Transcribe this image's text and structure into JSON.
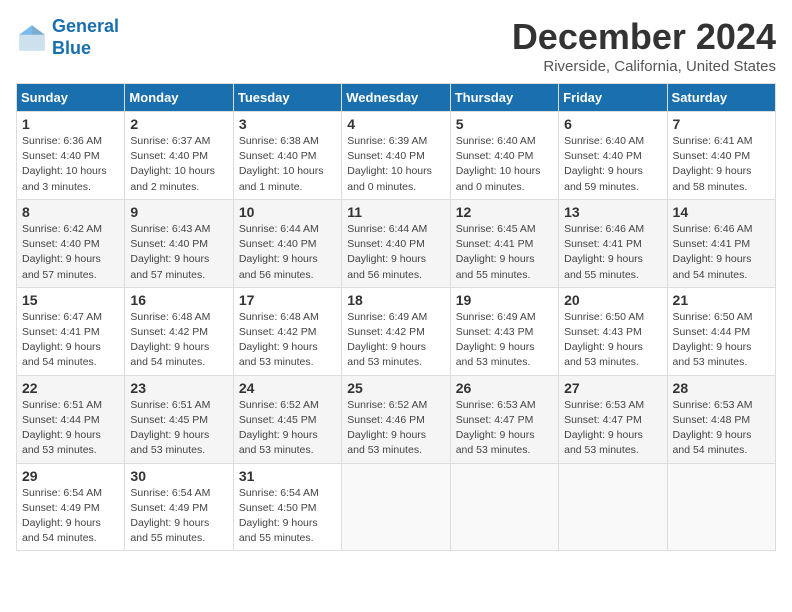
{
  "header": {
    "logo_line1": "General",
    "logo_line2": "Blue",
    "title": "December 2024",
    "subtitle": "Riverside, California, United States"
  },
  "calendar": {
    "days_of_week": [
      "Sunday",
      "Monday",
      "Tuesday",
      "Wednesday",
      "Thursday",
      "Friday",
      "Saturday"
    ],
    "weeks": [
      [
        {
          "day": "1",
          "sunrise": "6:36 AM",
          "sunset": "4:40 PM",
          "daylight": "10 hours and 3 minutes."
        },
        {
          "day": "2",
          "sunrise": "6:37 AM",
          "sunset": "4:40 PM",
          "daylight": "10 hours and 2 minutes."
        },
        {
          "day": "3",
          "sunrise": "6:38 AM",
          "sunset": "4:40 PM",
          "daylight": "10 hours and 1 minute."
        },
        {
          "day": "4",
          "sunrise": "6:39 AM",
          "sunset": "4:40 PM",
          "daylight": "10 hours and 0 minutes."
        },
        {
          "day": "5",
          "sunrise": "6:40 AM",
          "sunset": "4:40 PM",
          "daylight": "10 hours and 0 minutes."
        },
        {
          "day": "6",
          "sunrise": "6:40 AM",
          "sunset": "4:40 PM",
          "daylight": "9 hours and 59 minutes."
        },
        {
          "day": "7",
          "sunrise": "6:41 AM",
          "sunset": "4:40 PM",
          "daylight": "9 hours and 58 minutes."
        }
      ],
      [
        {
          "day": "8",
          "sunrise": "6:42 AM",
          "sunset": "4:40 PM",
          "daylight": "9 hours and 57 minutes."
        },
        {
          "day": "9",
          "sunrise": "6:43 AM",
          "sunset": "4:40 PM",
          "daylight": "9 hours and 57 minutes."
        },
        {
          "day": "10",
          "sunrise": "6:44 AM",
          "sunset": "4:40 PM",
          "daylight": "9 hours and 56 minutes."
        },
        {
          "day": "11",
          "sunrise": "6:44 AM",
          "sunset": "4:40 PM",
          "daylight": "9 hours and 56 minutes."
        },
        {
          "day": "12",
          "sunrise": "6:45 AM",
          "sunset": "4:41 PM",
          "daylight": "9 hours and 55 minutes."
        },
        {
          "day": "13",
          "sunrise": "6:46 AM",
          "sunset": "4:41 PM",
          "daylight": "9 hours and 55 minutes."
        },
        {
          "day": "14",
          "sunrise": "6:46 AM",
          "sunset": "4:41 PM",
          "daylight": "9 hours and 54 minutes."
        }
      ],
      [
        {
          "day": "15",
          "sunrise": "6:47 AM",
          "sunset": "4:41 PM",
          "daylight": "9 hours and 54 minutes."
        },
        {
          "day": "16",
          "sunrise": "6:48 AM",
          "sunset": "4:42 PM",
          "daylight": "9 hours and 54 minutes."
        },
        {
          "day": "17",
          "sunrise": "6:48 AM",
          "sunset": "4:42 PM",
          "daylight": "9 hours and 53 minutes."
        },
        {
          "day": "18",
          "sunrise": "6:49 AM",
          "sunset": "4:42 PM",
          "daylight": "9 hours and 53 minutes."
        },
        {
          "day": "19",
          "sunrise": "6:49 AM",
          "sunset": "4:43 PM",
          "daylight": "9 hours and 53 minutes."
        },
        {
          "day": "20",
          "sunrise": "6:50 AM",
          "sunset": "4:43 PM",
          "daylight": "9 hours and 53 minutes."
        },
        {
          "day": "21",
          "sunrise": "6:50 AM",
          "sunset": "4:44 PM",
          "daylight": "9 hours and 53 minutes."
        }
      ],
      [
        {
          "day": "22",
          "sunrise": "6:51 AM",
          "sunset": "4:44 PM",
          "daylight": "9 hours and 53 minutes."
        },
        {
          "day": "23",
          "sunrise": "6:51 AM",
          "sunset": "4:45 PM",
          "daylight": "9 hours and 53 minutes."
        },
        {
          "day": "24",
          "sunrise": "6:52 AM",
          "sunset": "4:45 PM",
          "daylight": "9 hours and 53 minutes."
        },
        {
          "day": "25",
          "sunrise": "6:52 AM",
          "sunset": "4:46 PM",
          "daylight": "9 hours and 53 minutes."
        },
        {
          "day": "26",
          "sunrise": "6:53 AM",
          "sunset": "4:47 PM",
          "daylight": "9 hours and 53 minutes."
        },
        {
          "day": "27",
          "sunrise": "6:53 AM",
          "sunset": "4:47 PM",
          "daylight": "9 hours and 53 minutes."
        },
        {
          "day": "28",
          "sunrise": "6:53 AM",
          "sunset": "4:48 PM",
          "daylight": "9 hours and 54 minutes."
        }
      ],
      [
        {
          "day": "29",
          "sunrise": "6:54 AM",
          "sunset": "4:49 PM",
          "daylight": "9 hours and 54 minutes."
        },
        {
          "day": "30",
          "sunrise": "6:54 AM",
          "sunset": "4:49 PM",
          "daylight": "9 hours and 55 minutes."
        },
        {
          "day": "31",
          "sunrise": "6:54 AM",
          "sunset": "4:50 PM",
          "daylight": "9 hours and 55 minutes."
        },
        null,
        null,
        null,
        null
      ]
    ]
  }
}
